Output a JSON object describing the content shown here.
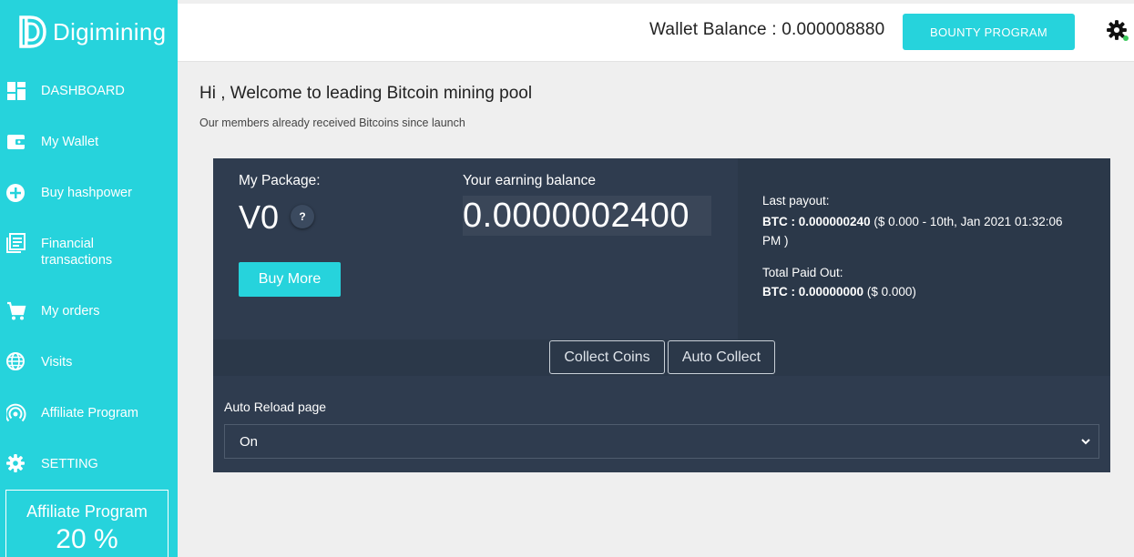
{
  "brand": {
    "name": "Digimining",
    "logo_icon": "digimining-logo-icon"
  },
  "colors": {
    "accent": "#26d3dc",
    "panel": "#2f3c4f",
    "panel_dark": "#2b3849",
    "background": "#efefef"
  },
  "sidebar": {
    "items": [
      {
        "label": "DASHBOARD",
        "icon": "dashboard-icon"
      },
      {
        "label": "My Wallet",
        "icon": "wallet-icon"
      },
      {
        "label": "Buy hashpower",
        "icon": "plus-circle-icon"
      },
      {
        "label": "Financial transactions",
        "icon": "document-list-icon"
      },
      {
        "label": "My orders",
        "icon": "cart-icon"
      },
      {
        "label": "Visits",
        "icon": "globe-icon"
      },
      {
        "label": "Affiliate Program",
        "icon": "broadcast-icon"
      },
      {
        "label": "SETTING",
        "icon": "gear-icon"
      }
    ],
    "affiliate_box": {
      "title": "Affiliate Program",
      "value": "20 %"
    }
  },
  "header": {
    "wallet_balance": "Wallet Balance : 0.000008880",
    "bounty_label": "BOUNTY PROGRAM",
    "settings_icon": "gear-icon"
  },
  "main": {
    "welcome": "Hi , Welcome to leading Bitcoin mining pool",
    "subtitle": "Our members already received Bitcoins since launch",
    "package": {
      "label": "My Package:",
      "value": "V0",
      "help": "?",
      "buy_label": "Buy More"
    },
    "earning": {
      "label": "Your earning balance",
      "value": "0.0000002400"
    },
    "last_payout": {
      "label": "Last payout:",
      "btc": "BTC : 0.000000240",
      "detail": " ($ 0.000 - 10th, Jan 2021 01:32:06 PM )"
    },
    "total_paid": {
      "label": "Total Paid Out:",
      "btc": "BTC : 0.00000000",
      "detail": " ($ 0.000)"
    },
    "buttons": {
      "collect": "Collect Coins",
      "auto_collect": "Auto Collect"
    },
    "auto_reload": {
      "label": "Auto Reload page",
      "selected": "On"
    }
  }
}
